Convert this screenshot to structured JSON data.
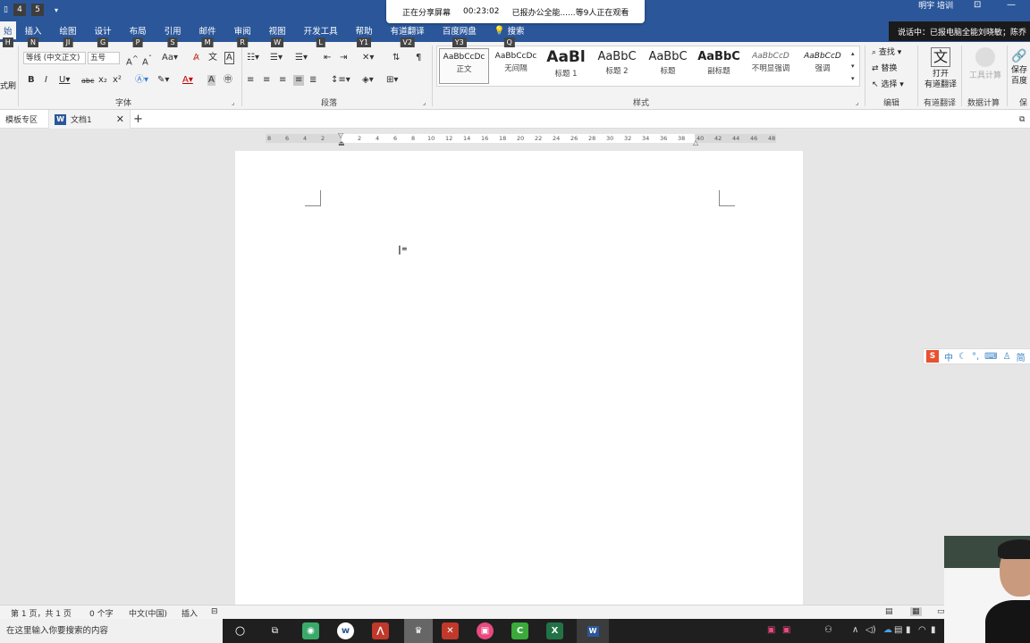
{
  "qat": {
    "key1": "4",
    "key2": "5"
  },
  "share": {
    "status": "正在分享屏幕",
    "timer": "00:23:02",
    "viewers": "已报办公全能......等9人正在观看"
  },
  "user_name": "明宇 培训",
  "speaking_banner": "说话中：已报电脑全能刘晓敏；陈乔",
  "tabs": [
    {
      "label": "始",
      "key": "H"
    },
    {
      "label": "插入",
      "key": "N"
    },
    {
      "label": "绘图",
      "key": "JI"
    },
    {
      "label": "设计",
      "key": "G"
    },
    {
      "label": "布局",
      "key": "P"
    },
    {
      "label": "引用",
      "key": "S"
    },
    {
      "label": "邮件",
      "key": "M"
    },
    {
      "label": "审阅",
      "key": "R"
    },
    {
      "label": "视图",
      "key": "W"
    },
    {
      "label": "开发工具",
      "key": "L"
    },
    {
      "label": "帮助",
      "key": "Y1"
    },
    {
      "label": "有道翻译",
      "key": "V2"
    },
    {
      "label": "百度网盘",
      "key": "Y3"
    },
    {
      "label": "搜索",
      "key": "Q"
    }
  ],
  "ribbon": {
    "format_painter": "式刷",
    "font_name": "等线 (中文正文)",
    "font_size": "五号",
    "font_group": "字体",
    "paragraph_group": "段落",
    "styles_group": "样式",
    "styles": [
      {
        "sample": "AaBbCcDc",
        "name": "正文"
      },
      {
        "sample": "AaBbCcDc",
        "name": "无间隔"
      },
      {
        "sample": "AaBl",
        "name": "标题 1"
      },
      {
        "sample": "AaBbC",
        "name": "标题 2"
      },
      {
        "sample": "AaBbC",
        "name": "标题"
      },
      {
        "sample": "AaBbC",
        "name": "副标题"
      },
      {
        "sample": "AaBbCcD",
        "name": "不明显强调"
      },
      {
        "sample": "AaBbCcD",
        "name": "强调"
      }
    ],
    "edit": {
      "find": "查找",
      "replace": "替换",
      "select": "选择",
      "group": "编辑"
    },
    "youdao": {
      "line1": "打开",
      "line2": "有道翻译",
      "group": "有道翻译"
    },
    "calc": {
      "button": "工具计算",
      "group": "数据计算"
    },
    "baidu": {
      "line1": "保存",
      "line2": "百度",
      "group": "保"
    }
  },
  "doctabs": {
    "template": "模板专区",
    "doc": "文档1"
  },
  "ruler": [
    "8",
    "6",
    "4",
    "2",
    "2",
    "4",
    "6",
    "8",
    "10",
    "12",
    "14",
    "16",
    "18",
    "20",
    "22",
    "24",
    "26",
    "28",
    "30",
    "32",
    "34",
    "36",
    "38",
    "40",
    "42",
    "44",
    "46",
    "48"
  ],
  "ime": {
    "logo": "S",
    "mode": "中",
    "simplified": "简"
  },
  "status": {
    "page": "第 1 页，共 1 页",
    "words": "0 个字",
    "lang": "中文(中国)",
    "mode": "插入"
  },
  "taskbar": {
    "search_placeholder": "在这里输入你要搜索的内容"
  }
}
